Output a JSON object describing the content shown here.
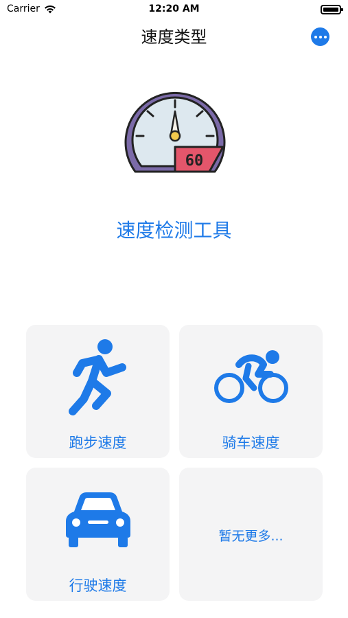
{
  "status_bar": {
    "carrier": "Carrier",
    "time": "12:20 AM",
    "icons": [
      "wifi-icon",
      "battery-icon"
    ]
  },
  "nav": {
    "title": "速度类型",
    "more_icon": "more-icon"
  },
  "hero": {
    "gauge_value": "60",
    "title": "速度检测工具"
  },
  "cards": [
    {
      "icon": "running-icon",
      "label": "跑步速度"
    },
    {
      "icon": "cycling-icon",
      "label": "骑车速度"
    },
    {
      "icon": "car-icon",
      "label": "行驶速度"
    },
    {
      "icon": "",
      "label": "暂无更多..."
    }
  ],
  "colors": {
    "accent": "#1e7ae8",
    "card_bg": "#f4f4f5",
    "gauge_ring": "#7b6aa8",
    "gauge_face": "#dde8ef",
    "gauge_badge": "#e4566b",
    "gauge_needle": "#f2c94c"
  }
}
